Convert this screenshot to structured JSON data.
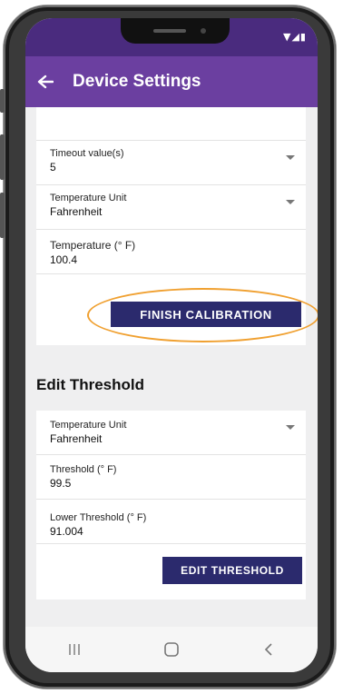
{
  "status_bar": {
    "icons": "▼◢▮"
  },
  "app_bar": {
    "title": "Device Settings",
    "back_icon": "arrow-left-icon"
  },
  "calibration": {
    "timeout": {
      "label": "Timeout value(s)",
      "value": "5"
    },
    "temp_unit": {
      "label": "Temperature Unit",
      "value": "Fahrenheit"
    },
    "temperature": {
      "label": "Temperature (° F)",
      "value": "100.4"
    },
    "finish_label": "FINISH CALIBRATION"
  },
  "threshold": {
    "section_title": "Edit Threshold",
    "temp_unit": {
      "label": "Temperature Unit",
      "value": "Fahrenheit"
    },
    "upper": {
      "label": "Threshold (° F)",
      "value": "99.5"
    },
    "lower": {
      "label": "Lower Threshold (° F)",
      "value": "91.004"
    },
    "edit_label": "EDIT THRESHOLD"
  },
  "nav_bar": {
    "recents_icon": "recents-icon",
    "home_icon": "home-icon",
    "back_icon": "back-chevron-icon"
  },
  "colors": {
    "status_bar": "#4a2b7e",
    "app_bar": "#6b3fa0",
    "button": "#2b2a6d",
    "highlight": "#f0a030"
  }
}
